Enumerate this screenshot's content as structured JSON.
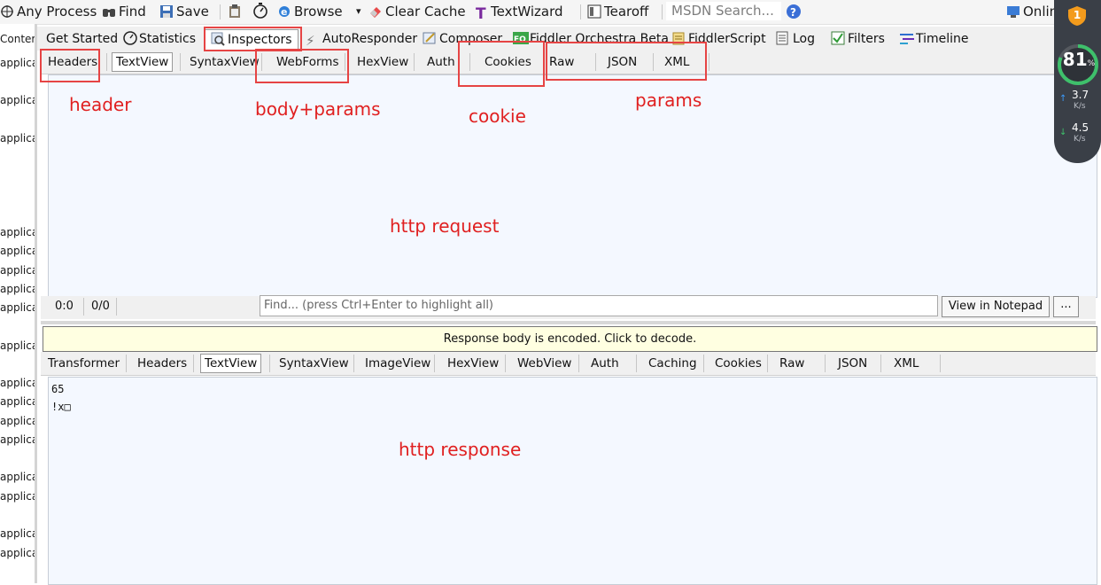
{
  "toolbar": {
    "process": "Any Process",
    "find": "Find",
    "save": "Save",
    "browse": "Browse",
    "clear_cache": "Clear Cache",
    "text_wizard": "TextWizard",
    "tearoff": "Tearoff",
    "search_placeholder": "MSDN Search...",
    "online": "Online"
  },
  "left_column": {
    "header": "Conter",
    "rows": [
      "applica",
      "applica",
      "applica",
      "applica",
      "applica",
      "applica",
      "applica",
      "applica",
      "applica",
      "applica",
      "applica",
      "applica",
      "applica",
      "applica",
      "applica",
      "applica",
      "applica"
    ]
  },
  "main_tabs": [
    "Get Started",
    "Statistics",
    "Inspectors",
    "AutoResponder",
    "Composer",
    "Fiddler Orchestra Beta",
    "FiddlerScript",
    "Log",
    "Filters",
    "Timeline"
  ],
  "request_tabs": [
    "Headers",
    "TextView",
    "SyntaxView",
    "WebForms",
    "HexView",
    "Auth",
    "Cookies",
    "Raw",
    "JSON",
    "XML"
  ],
  "find_bar": {
    "pos": "0:0",
    "count": "0/0",
    "placeholder": "Find... (press Ctrl+Enter to highlight all)",
    "view_notepad": "View in Notepad",
    "more": "..."
  },
  "notice": "Response body is encoded. Click to decode.",
  "response_tabs": [
    "Transformer",
    "Headers",
    "TextView",
    "SyntaxView",
    "ImageView",
    "HexView",
    "WebView",
    "Auth",
    "Caching",
    "Cookies",
    "Raw",
    "JSON",
    "XML"
  ],
  "response_body": "65\n!x□",
  "annotations": {
    "header": "header",
    "body_params": "body+params",
    "cookie": "cookie",
    "params": "params",
    "http_request": "http request",
    "http_response": "http response"
  },
  "widget": {
    "badge": "1",
    "percent": "81",
    "percent_unit": "%",
    "up_speed": "3.7",
    "down_speed": "4.5",
    "speed_unit": "K/s"
  },
  "colors": {
    "annotation": "#e02020",
    "widget_bg": "#3a3f47",
    "gauge_green": "#3ec06b"
  }
}
